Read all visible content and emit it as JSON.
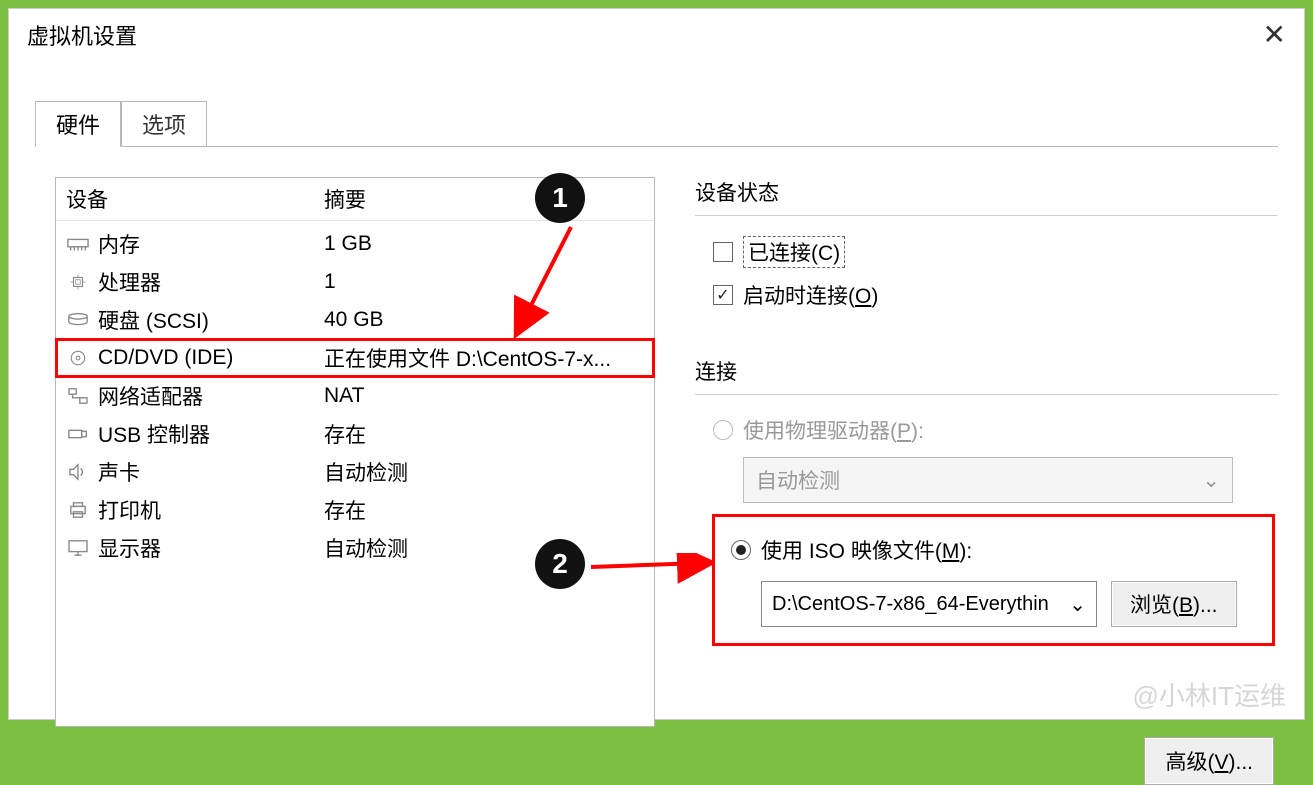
{
  "window": {
    "title": "虚拟机设置"
  },
  "tabs": {
    "hardware": "硬件",
    "options": "选项"
  },
  "table": {
    "col1": "设备",
    "col2": "摘要",
    "rows": [
      {
        "name": "内存",
        "summary": "1 GB",
        "icon": "memory"
      },
      {
        "name": "处理器",
        "summary": "1",
        "icon": "cpu"
      },
      {
        "name": "硬盘 (SCSI)",
        "summary": "40 GB",
        "icon": "disk"
      },
      {
        "name": "CD/DVD (IDE)",
        "summary": "正在使用文件 D:\\CentOS-7-x...",
        "icon": "cd",
        "selected": true
      },
      {
        "name": "网络适配器",
        "summary": "NAT",
        "icon": "net"
      },
      {
        "name": "USB 控制器",
        "summary": "存在",
        "icon": "usb"
      },
      {
        "name": "声卡",
        "summary": "自动检测",
        "icon": "sound"
      },
      {
        "name": "打印机",
        "summary": "存在",
        "icon": "printer"
      },
      {
        "name": "显示器",
        "summary": "自动检测",
        "icon": "display"
      }
    ]
  },
  "right": {
    "status_label": "设备状态",
    "connected": "已连接(C)",
    "connect_at_power": "启动时连接(O)",
    "connection_label": "连接",
    "use_physical": "使用物理驱动器(P):",
    "autodetect": "自动检测",
    "use_iso": "使用 ISO 映像文件(M):",
    "iso_path": "D:\\CentOS-7-x86_64-Everythin",
    "browse": "浏览(B)...",
    "advanced": "高级(V)..."
  },
  "callouts": {
    "one": "1",
    "two": "2"
  },
  "watermark": "@小林IT运维"
}
